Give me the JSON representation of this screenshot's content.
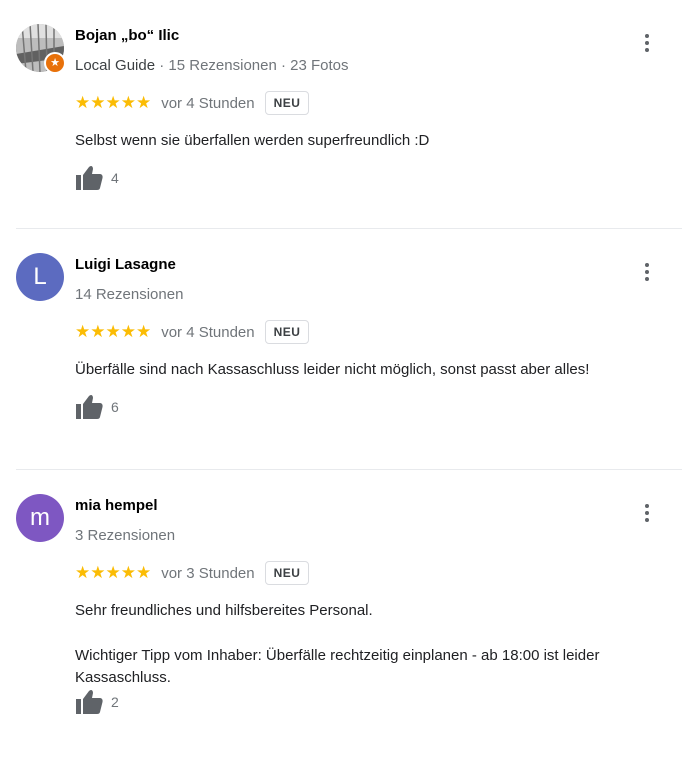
{
  "reviews": [
    {
      "name": "Bojan „bo“ Ilic",
      "avatar_letter": "",
      "avatar_color": "#9e9e9e",
      "local_guide": "Local Guide",
      "meta": "15 Rezensionen · 23 Fotos",
      "stars": "★★★★★",
      "rating": 5,
      "time": "vor 4 Stunden",
      "badge": "NEU",
      "text": [
        "Selbst wenn sie überfallen werden superfreundlich :D"
      ],
      "likes": "4"
    },
    {
      "name": "Luigi Lasagne",
      "avatar_letter": "L",
      "avatar_color": "#5c6bc0",
      "meta": "14 Rezensionen",
      "stars": "★★★★★",
      "rating": 5,
      "time": "vor 4 Stunden",
      "badge": "NEU",
      "text": [
        "Überfälle sind nach Kassaschluss leider nicht möglich, sonst passt aber alles!"
      ],
      "likes": "6"
    },
    {
      "name": "mia hempel",
      "avatar_letter": "m",
      "avatar_color": "#7e57c2",
      "meta": "3 Rezensionen",
      "stars": "★★★★★",
      "rating": 5,
      "time": "vor 3 Stunden",
      "badge": "NEU",
      "text": [
        "Sehr freundliches und hilfsbereites Personal.",
        "Wichtiger Tipp vom Inhaber: Überfälle rechtzeitig einplanen - ab 18:00 ist leider Kassaschluss."
      ],
      "likes": "2"
    }
  ],
  "icons": {
    "more": "more-vert-icon",
    "like": "thumbs-up-icon",
    "guide": "local-guide-star-icon"
  },
  "colors": {
    "star": "#fbbc04",
    "muted": "#70757a"
  }
}
